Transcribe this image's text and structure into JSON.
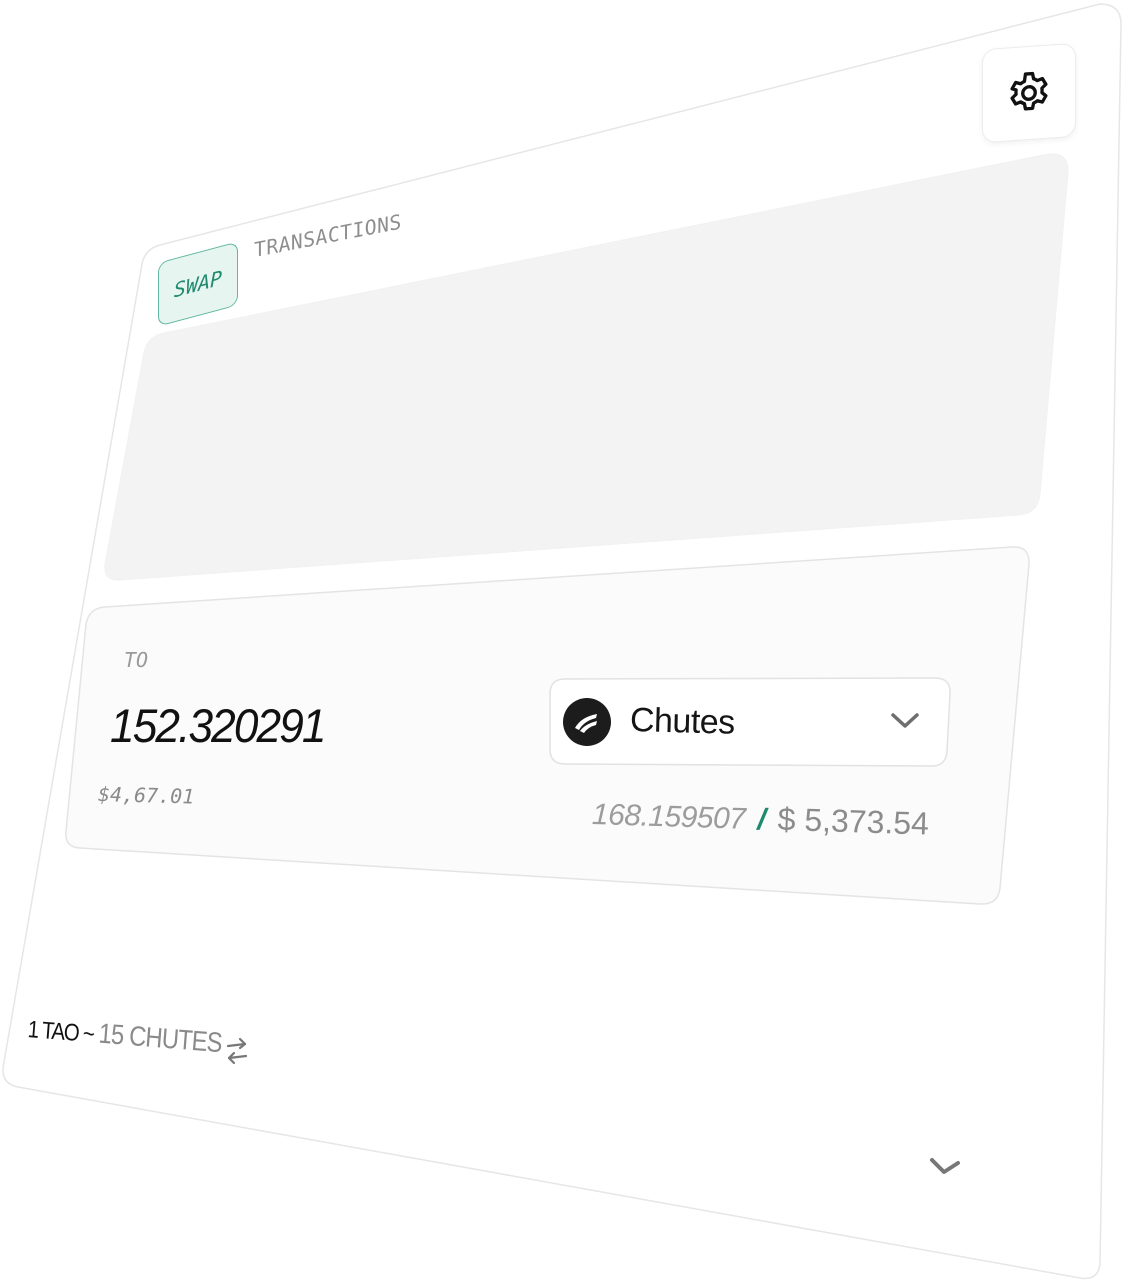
{
  "header": {
    "settings_icon": "gear-icon"
  },
  "tabs": [
    {
      "label": "SWAP",
      "active": true
    },
    {
      "label": "TRANSACTIONS",
      "active": false
    }
  ],
  "to_section": {
    "label": "TO",
    "amount": "152.320291",
    "usd_value": "$4,67.01"
  },
  "token": {
    "name": "Chutes",
    "logo_icon": "chutes-logo-icon",
    "dropdown_icon": "chevron-down-icon"
  },
  "balance": {
    "amount": "168.159507",
    "separator": "/",
    "usd": "$ 5,373.54"
  },
  "rate": {
    "base": "1 TAO ~ ",
    "quote": "15 CHUTES",
    "swap_icon": "swap-arrows-icon"
  },
  "footer": {
    "expand_icon": "chevron-down-icon"
  },
  "colors": {
    "accent": "#1f8a6d",
    "tab_active_bg": "#e7f5f0",
    "panel_bg": "#f3f3f3",
    "text_primary": "#111111",
    "text_muted": "#8a8a8a"
  }
}
